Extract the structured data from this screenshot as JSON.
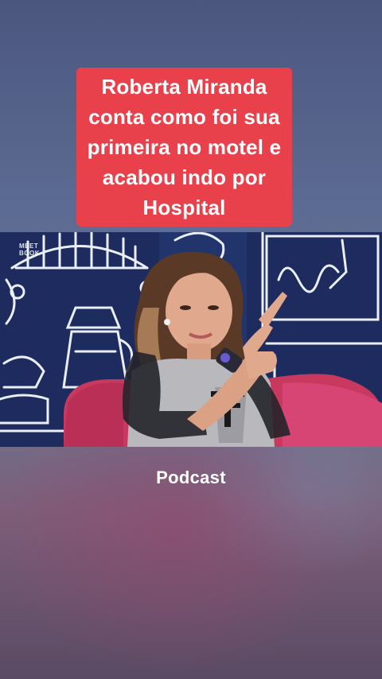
{
  "caption": {
    "text": "Roberta Miranda\nconta como foi sua\nprimeira no motel e\nacabou indo por\nHospital"
  },
  "video": {
    "watermark": "MEET\nBOOK"
  },
  "footer": {
    "label": "Podcast"
  },
  "colors": {
    "caption_background": "#e8414c",
    "caption_text": "#ffffff",
    "video_background": "#1c2a5c"
  }
}
